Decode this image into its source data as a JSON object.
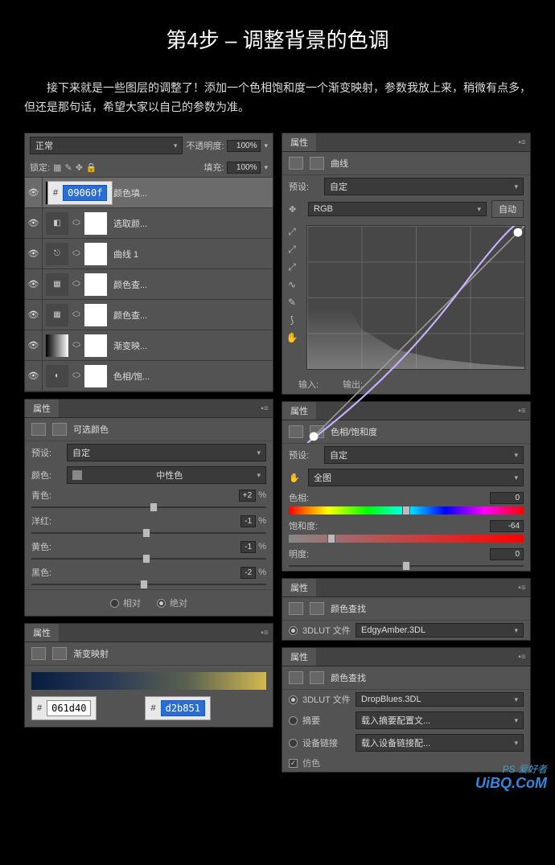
{
  "title": "第4步 – 调整背景的色调",
  "intro": "接下来就是一些图层的调整了！添加一个色相饱和度一个渐变映射，参数我放上来，稍微有点多，但还是那句话，希望大家以自己的参数为准。",
  "layers": {
    "blend": "正常",
    "opacity_lbl": "不透明度:",
    "opacity": "100%",
    "lock_lbl": "锁定:",
    "fill_lbl": "填充:",
    "fill": "100%",
    "items": [
      {
        "name": "颜色填..."
      },
      {
        "name": "选取颜..."
      },
      {
        "name": "曲线 1"
      },
      {
        "name": "颜色查..."
      },
      {
        "name": "颜色查..."
      },
      {
        "name": "渐变映..."
      },
      {
        "name": "色相/饱..."
      }
    ]
  },
  "hex_fill": "09060f",
  "sel_color": {
    "panel": "属性",
    "title": "可选颜色",
    "preset_lbl": "预设:",
    "preset": "自定",
    "color_lbl": "颜色:",
    "color": "中性色",
    "sliders": [
      {
        "lbl": "青色:",
        "val": "+2",
        "pos": 52
      },
      {
        "lbl": "洋红:",
        "val": "-1",
        "pos": 49
      },
      {
        "lbl": "黄色:",
        "val": "-1",
        "pos": 49
      },
      {
        "lbl": "黑色:",
        "val": "-2",
        "pos": 48
      }
    ],
    "pct": "%",
    "rel": "相对",
    "abs": "绝对"
  },
  "gradmap": {
    "panel": "属性",
    "title": "渐变映射",
    "hex1": "061d40",
    "hex2": "d2b851"
  },
  "curves": {
    "panel": "属性",
    "title": "曲线",
    "preset_lbl": "预设:",
    "preset": "自定",
    "channel": "RGB",
    "auto": "自动",
    "input": "输入:",
    "output": "输出:"
  },
  "huesat": {
    "panel": "属性",
    "title": "色相/饱和度",
    "preset_lbl": "预设:",
    "preset": "自定",
    "range_lbl": "",
    "range": "全图",
    "hue_lbl": "色相:",
    "hue": "0",
    "sat_lbl": "饱和度:",
    "sat": "-64",
    "light_lbl": "明度:",
    "light": "0"
  },
  "lut1": {
    "panel": "属性",
    "title": "颜色查找",
    "file_lbl": "3DLUT 文件",
    "file": "EdgyAmber.3DL"
  },
  "lut2": {
    "panel": "属性",
    "title": "颜色查找",
    "file_lbl": "3DLUT 文件",
    "file": "DropBlues.3DL",
    "abs_lbl": "摘要",
    "abs": "载入摘要配置文...",
    "dev_lbl": "设备链接",
    "dev": "载入设备链接配...",
    "dither": "仿色"
  },
  "watermark": "UiBQ.CoM",
  "wm2": "PS 爱好者"
}
